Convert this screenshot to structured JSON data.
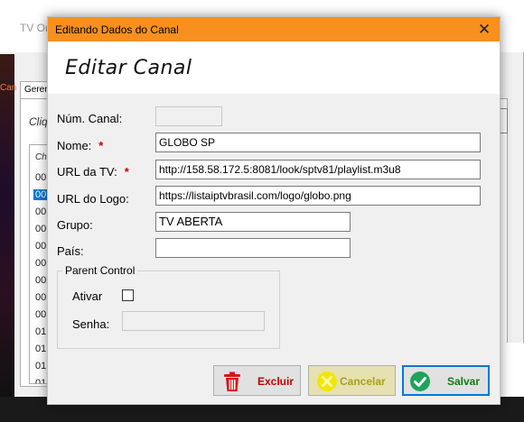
{
  "background_window": {
    "title_fragment": "TV On",
    "tab_label": "Gerer",
    "strip_text": "Can",
    "hint_text": "Cliq",
    "list_header": "Ch",
    "list_items": [
      "00",
      "00",
      "00",
      "00",
      "00",
      "00",
      "00",
      "00",
      "00",
      "01",
      "01",
      "01",
      "01"
    ]
  },
  "dialog": {
    "title": "Editando Dados do Canal",
    "close_glyph": "✕",
    "heading": "Editar Canal",
    "fields": {
      "channel_num": {
        "label": "Núm. Canal:",
        "value": ""
      },
      "name": {
        "label": "Nome:",
        "required_mark": "*",
        "value": "GLOBO SP"
      },
      "tv_url": {
        "label": "URL da TV:",
        "required_mark": "*",
        "value": "http://158.58.172.5:8081/look/sptv81/playlist.m3u8"
      },
      "logo_url": {
        "label": "URL do Logo:",
        "value": "https://listaiptvbrasil.com/logo/globo.png"
      },
      "group": {
        "label": "Grupo:",
        "value": "TV ABERTA"
      },
      "country": {
        "label": "País:",
        "value": ""
      }
    },
    "parent_control": {
      "legend": "Parent Control",
      "enable_label": "Ativar",
      "enabled": false,
      "password_label": "Senha:",
      "password_value": ""
    },
    "buttons": {
      "delete": {
        "label": "Excluir",
        "icon": "trash-icon"
      },
      "cancel": {
        "label": "Cancelar",
        "icon": "cancel-icon"
      },
      "save": {
        "label": "Salvar",
        "icon": "check-icon"
      }
    },
    "colors": {
      "titlebar": "#f7901e",
      "required": "#c00000",
      "delete": "#c00000",
      "cancel": "#a8a01a",
      "save": "#107c10",
      "focus": "#0078d7"
    }
  }
}
